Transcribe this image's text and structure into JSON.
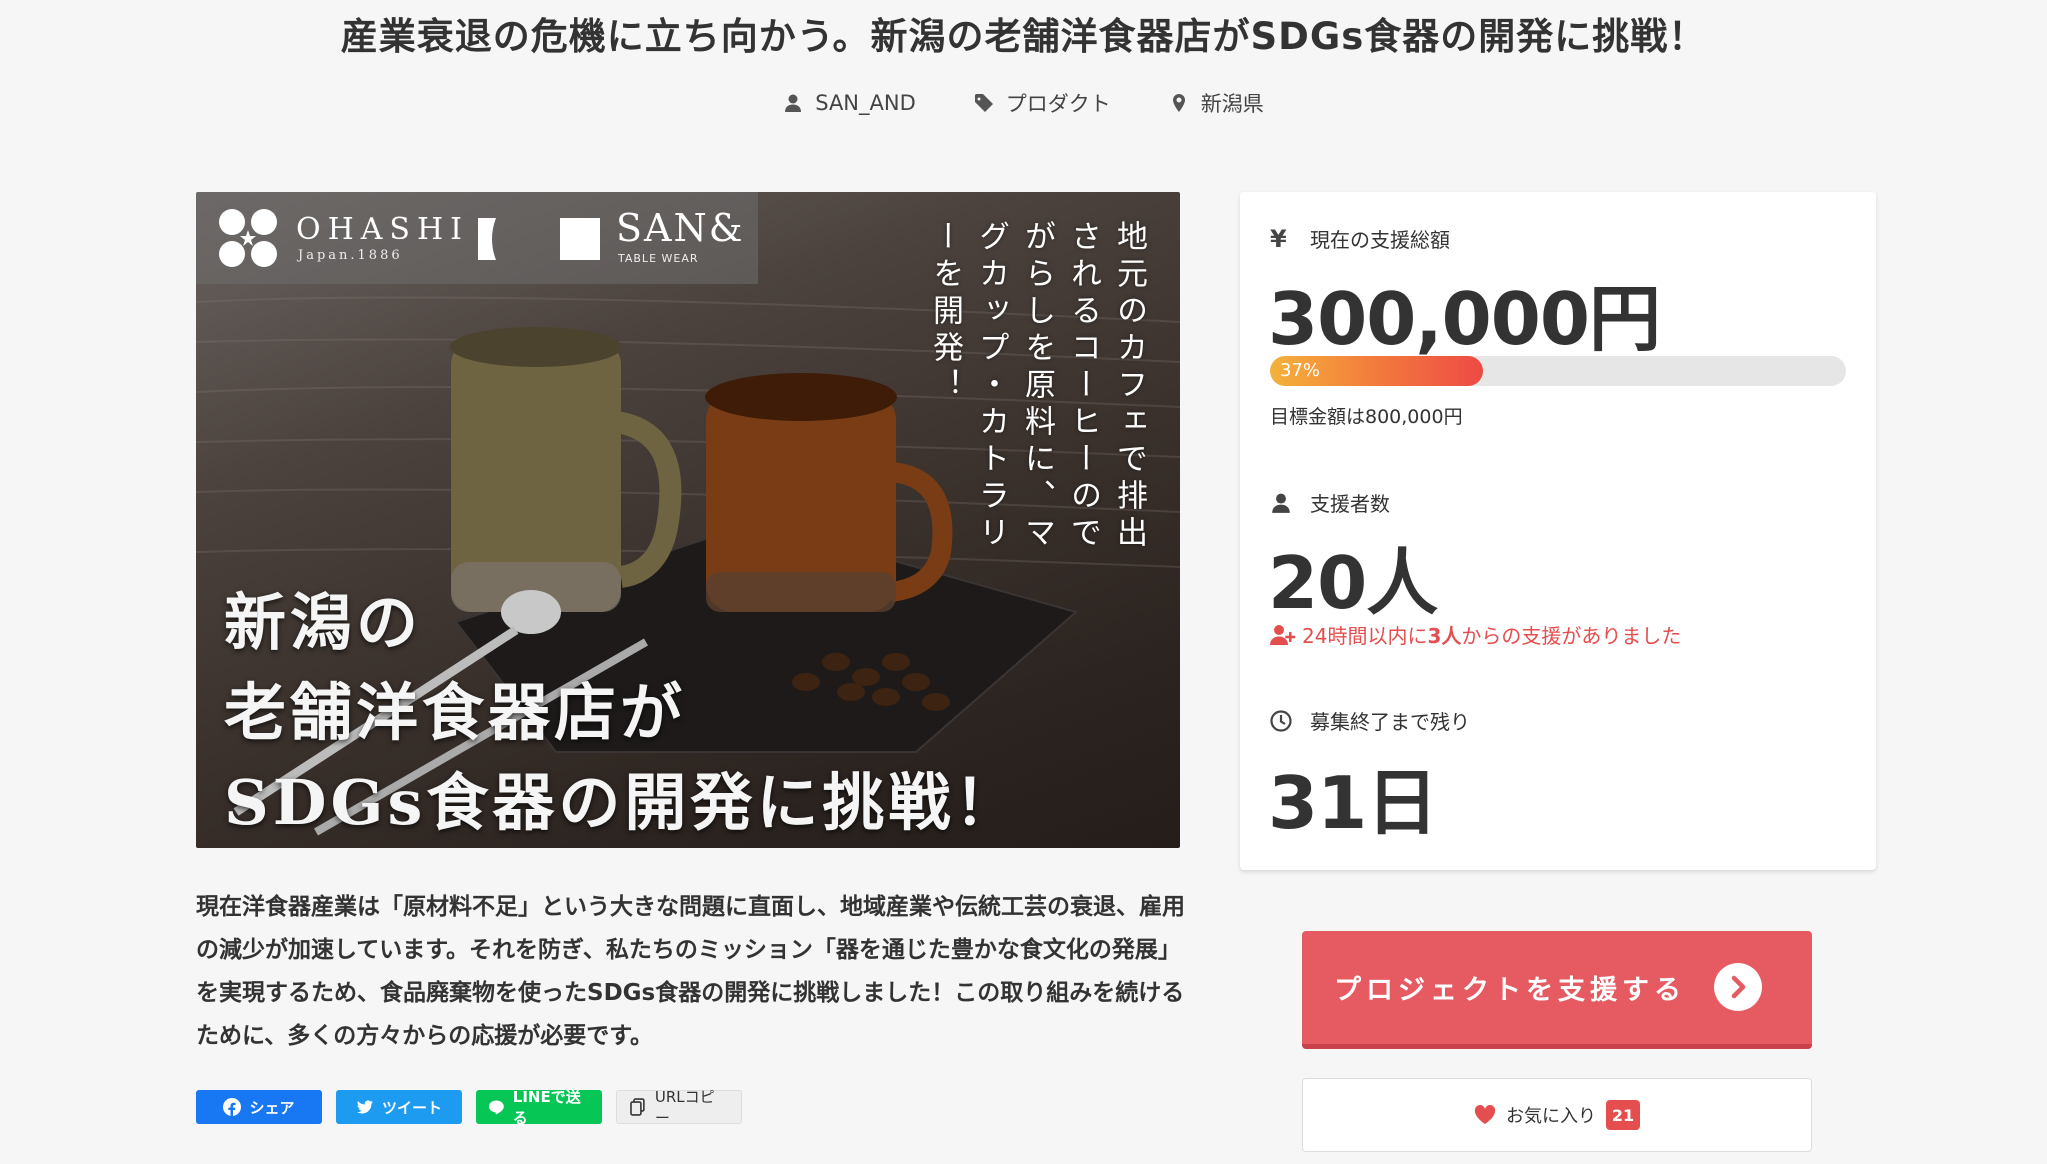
{
  "title": "産業衰退の危機に立ち向かう。新潟の老舗洋食器店がSDGs食器の開発に挑戦！",
  "meta": {
    "author": "SAN_AND",
    "category": "プロダクト",
    "location": "新潟県"
  },
  "hero": {
    "logo_ohashi": "OHASHI",
    "logo_japan": "Japan.1886",
    "logo_san": "SAN&",
    "logo_tablewear": "TABLE WEAR",
    "vertical_text": "地元のカフェで排出されるコーヒーのでがらしを原料に、マグカップ・カトラリーを開発！",
    "headline_1": "新潟の",
    "headline_2": "老舗洋食器店が",
    "headline_3": "SDGs食器の開発に挑戦！"
  },
  "description": "現在洋食器産業は「原材料不足」という大きな問題に直面し、地域産業や伝統工芸の衰退、雇用の減少が加速しています。それを防ぎ、私たちのミッション「器を通じた豊かな食文化の発展」を実現するため、食品廃棄物を使ったSDGs食器の開発に挑戦しました！この取り組みを続けるために、多くの方々からの応援が必要です。",
  "share": {
    "facebook": "シェア",
    "twitter": "ツイート",
    "line": "LINEで送る",
    "url": "URLコピー"
  },
  "stats": {
    "funded_label": "現在の支援総額",
    "funded_amount": "300,000円",
    "progress_text": "37%",
    "progress_value": 37,
    "goal_text": "目標金額は800,000円",
    "supporters_label": "支援者数",
    "supporters_count": "20人",
    "recent_prefix": "24時間以内に",
    "recent_count": "3人",
    "recent_suffix": "からの支援がありました",
    "remaining_label": "募集終了まで残り",
    "remaining_days": "31日"
  },
  "actions": {
    "support_label": "プロジェクトを支援する",
    "favorite_label": "お気に入り",
    "favorite_count": "21"
  },
  "colors": {
    "accent": "#e65a62",
    "alert": "#e54e4e",
    "facebook": "#1877f2",
    "twitter": "#1d9bf0",
    "line": "#06c755"
  }
}
